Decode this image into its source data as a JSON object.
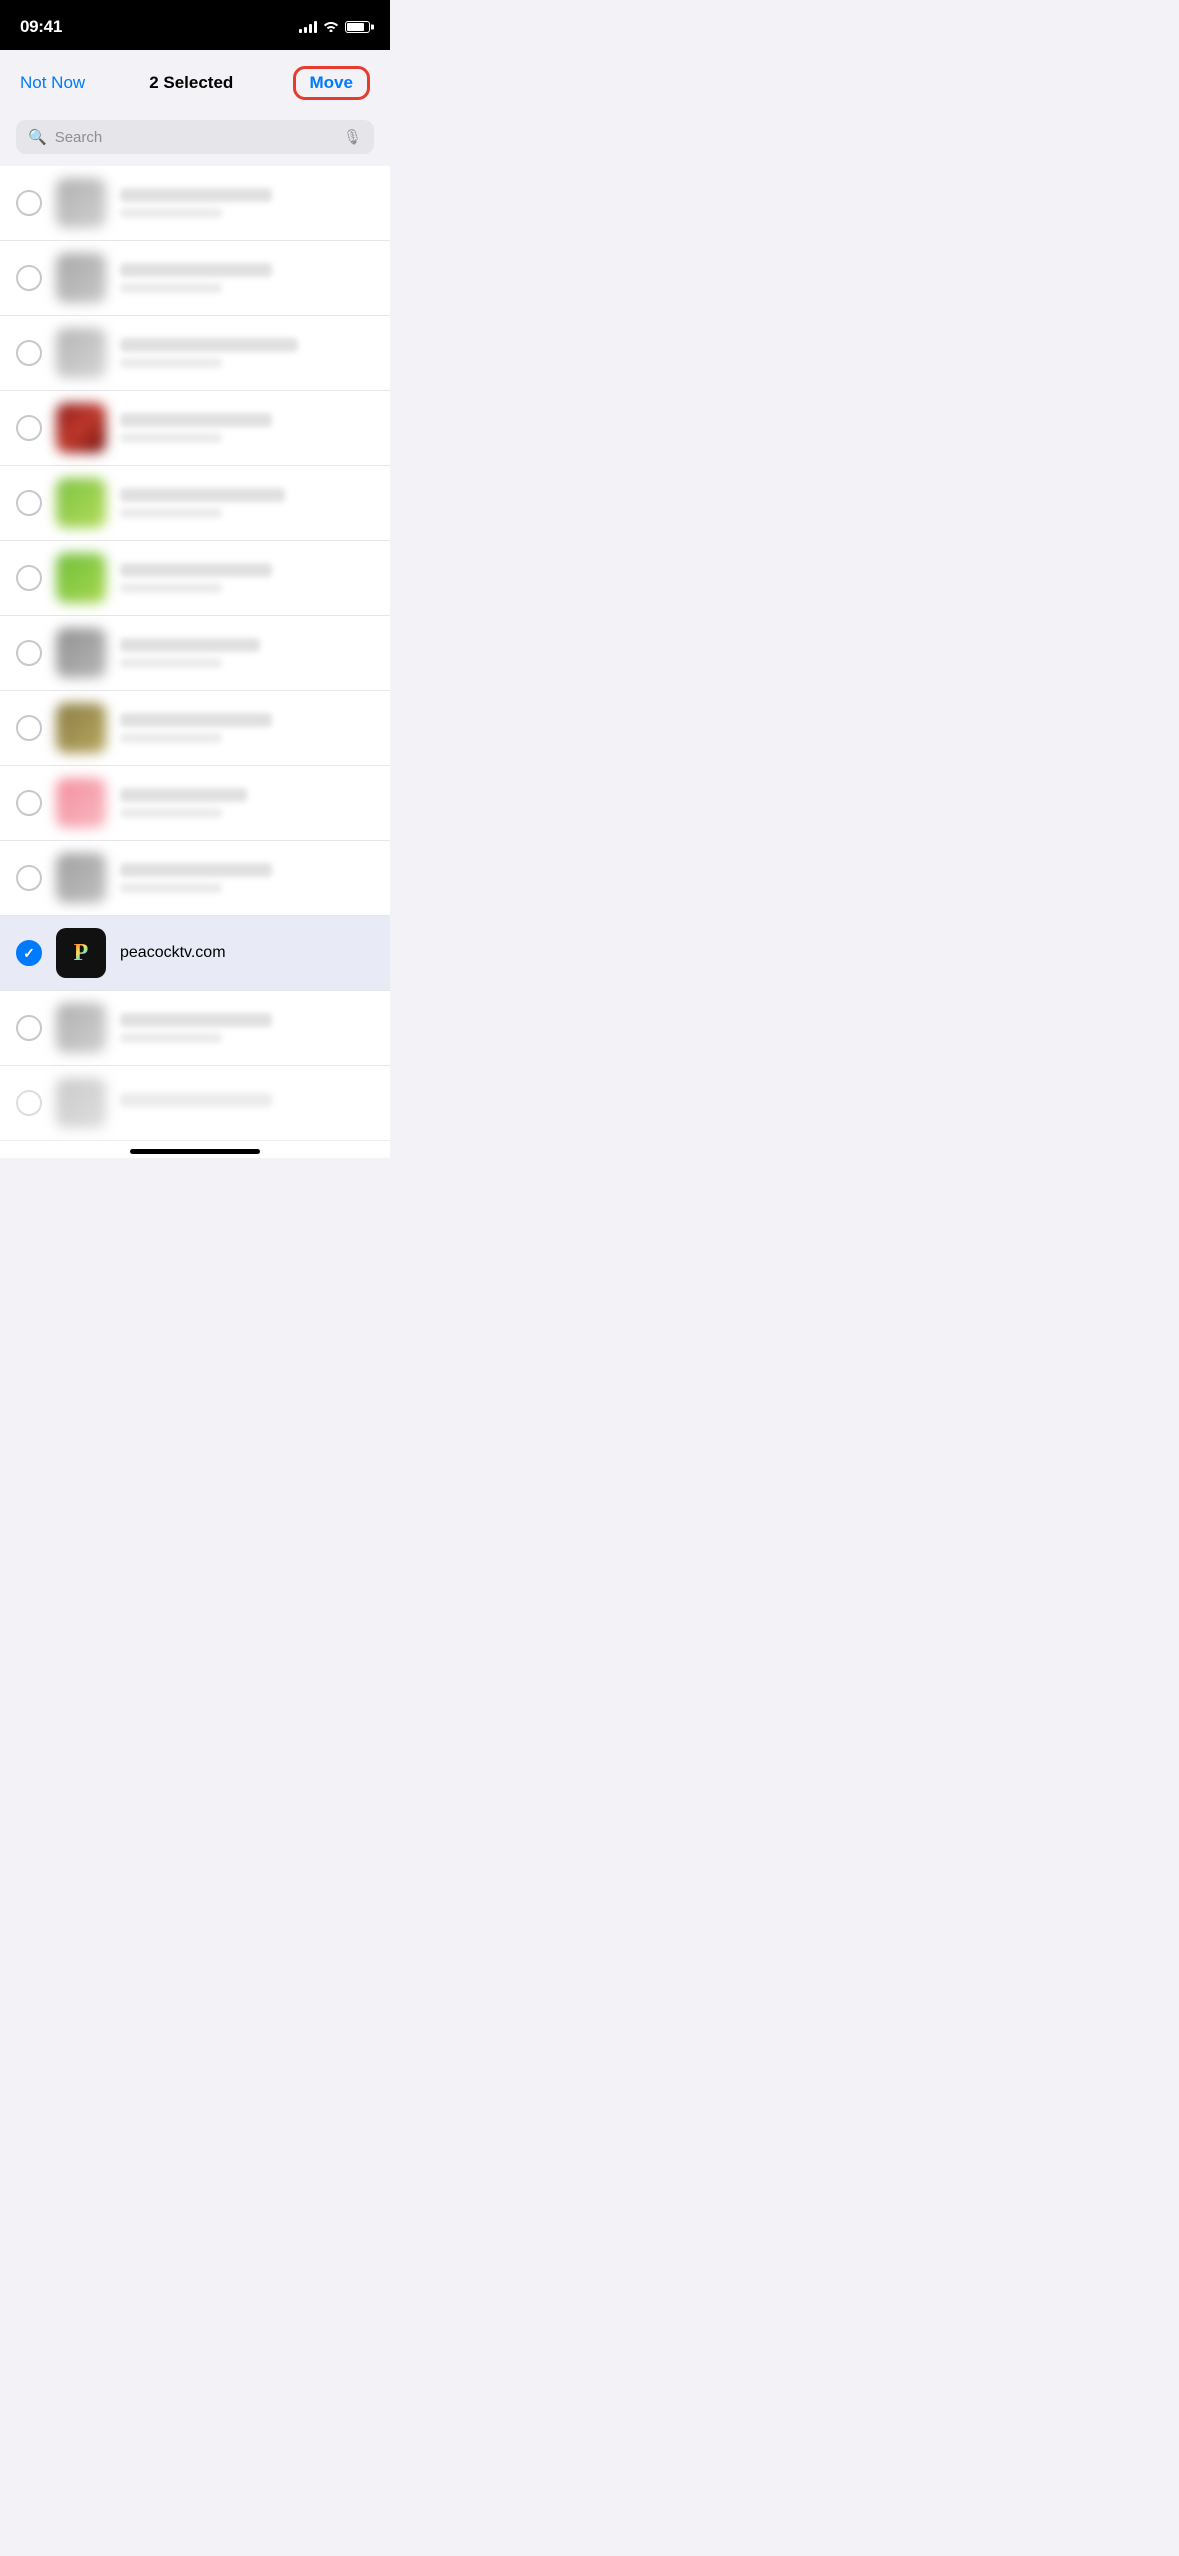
{
  "statusBar": {
    "time": "09:41",
    "batteryLevel": 80
  },
  "navBar": {
    "notNow": "Not Now",
    "title": "2 Selected",
    "moveBtn": "Move"
  },
  "search": {
    "placeholder": "Search"
  },
  "listItems": [
    {
      "id": 1,
      "iconClass": "icon-gray-1",
      "selected": false,
      "hasText": true
    },
    {
      "id": 2,
      "iconClass": "icon-gray-2",
      "selected": false,
      "hasText": true
    },
    {
      "id": 3,
      "iconClass": "icon-gray-3",
      "selected": false,
      "hasText": true
    },
    {
      "id": 4,
      "iconClass": "icon-red",
      "selected": false,
      "hasText": true
    },
    {
      "id": 5,
      "iconClass": "icon-green-1",
      "selected": false,
      "hasText": true
    },
    {
      "id": 6,
      "iconClass": "icon-green-2",
      "selected": false,
      "hasText": true
    },
    {
      "id": 7,
      "iconClass": "icon-gray-4",
      "selected": false,
      "hasText": true
    },
    {
      "id": 8,
      "iconClass": "icon-olive",
      "selected": false,
      "hasText": true
    },
    {
      "id": 9,
      "iconClass": "icon-pink",
      "selected": false,
      "hasText": true
    },
    {
      "id": 10,
      "iconClass": "icon-gray-5",
      "selected": false,
      "hasText": true
    },
    {
      "id": 11,
      "iconClass": "icon-peacock",
      "selected": true,
      "title": "peacocktv.com"
    },
    {
      "id": 12,
      "iconClass": "icon-gray-1",
      "selected": false,
      "hasText": true
    },
    {
      "id": 13,
      "iconClass": "icon-gray-2",
      "selected": false,
      "hasText": true
    }
  ]
}
